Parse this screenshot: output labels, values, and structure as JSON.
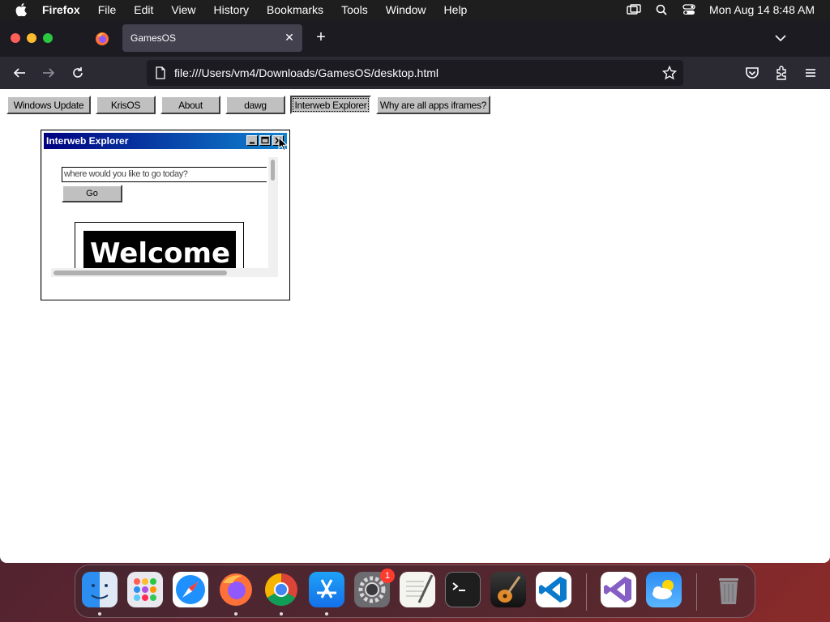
{
  "menubar": {
    "app_name": "Firefox",
    "items": [
      "File",
      "Edit",
      "View",
      "History",
      "Bookmarks",
      "Tools",
      "Window",
      "Help"
    ],
    "clock": "Mon Aug 14  8:48 AM"
  },
  "browser": {
    "tab_title": "GamesOS",
    "url": "file:///Users/vm4/Downloads/GamesOS/desktop.html"
  },
  "appbar": {
    "buttons": [
      "Windows Update",
      "KrisOS",
      "About",
      "dawg",
      "Interweb Explorer",
      "Why are all apps iframes?"
    ]
  },
  "window": {
    "title": "Interweb Explorer",
    "minimize_label": "_",
    "maximize_label": "□",
    "close_label": "×",
    "url_placeholder": "where would you like to go today?",
    "go_label": "Go",
    "welcome_text": "Welcome"
  },
  "dock": {
    "badge_count": "1",
    "apps": [
      "finder",
      "launchpad",
      "safari",
      "firefox",
      "chrome",
      "app-store",
      "system-settings",
      "textedit",
      "terminal",
      "garageband",
      "vscode",
      "visual-studio",
      "weather",
      "trash"
    ]
  }
}
